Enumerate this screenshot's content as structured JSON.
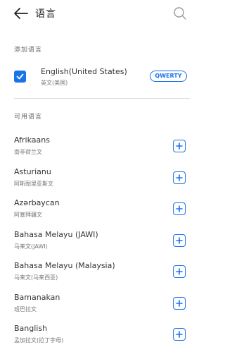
{
  "header": {
    "title": "语言",
    "back_icon": "arrow-left-icon",
    "search_icon": "search-icon"
  },
  "sections": {
    "added_label": "添加语言",
    "available_label": "可用语言"
  },
  "added_language": {
    "name": "English(United States)",
    "native": "英文(美国)",
    "checked": true,
    "keyboard": "QWERTY"
  },
  "languages": [
    {
      "name": "Afrikaans",
      "native": "南非荷兰文"
    },
    {
      "name": "Asturianu",
      "native": "阿斯图里亚斯文"
    },
    {
      "name": "Azərbaycan",
      "native": "阿塞拜疆文"
    },
    {
      "name": "Bahasa Melayu (JAWI)",
      "native": "马来文(JAWI)"
    },
    {
      "name": "Bahasa Melayu (Malaysia)",
      "native": "马来文(马来西亚)"
    },
    {
      "name": "Bamanakan",
      "native": "班巴拉文"
    },
    {
      "name": "Banglish",
      "native": "孟加拉文(拉丁字母)"
    }
  ],
  "colors": {
    "accent": "#1a73e8",
    "background": "#ffffff",
    "text": "#333333"
  }
}
